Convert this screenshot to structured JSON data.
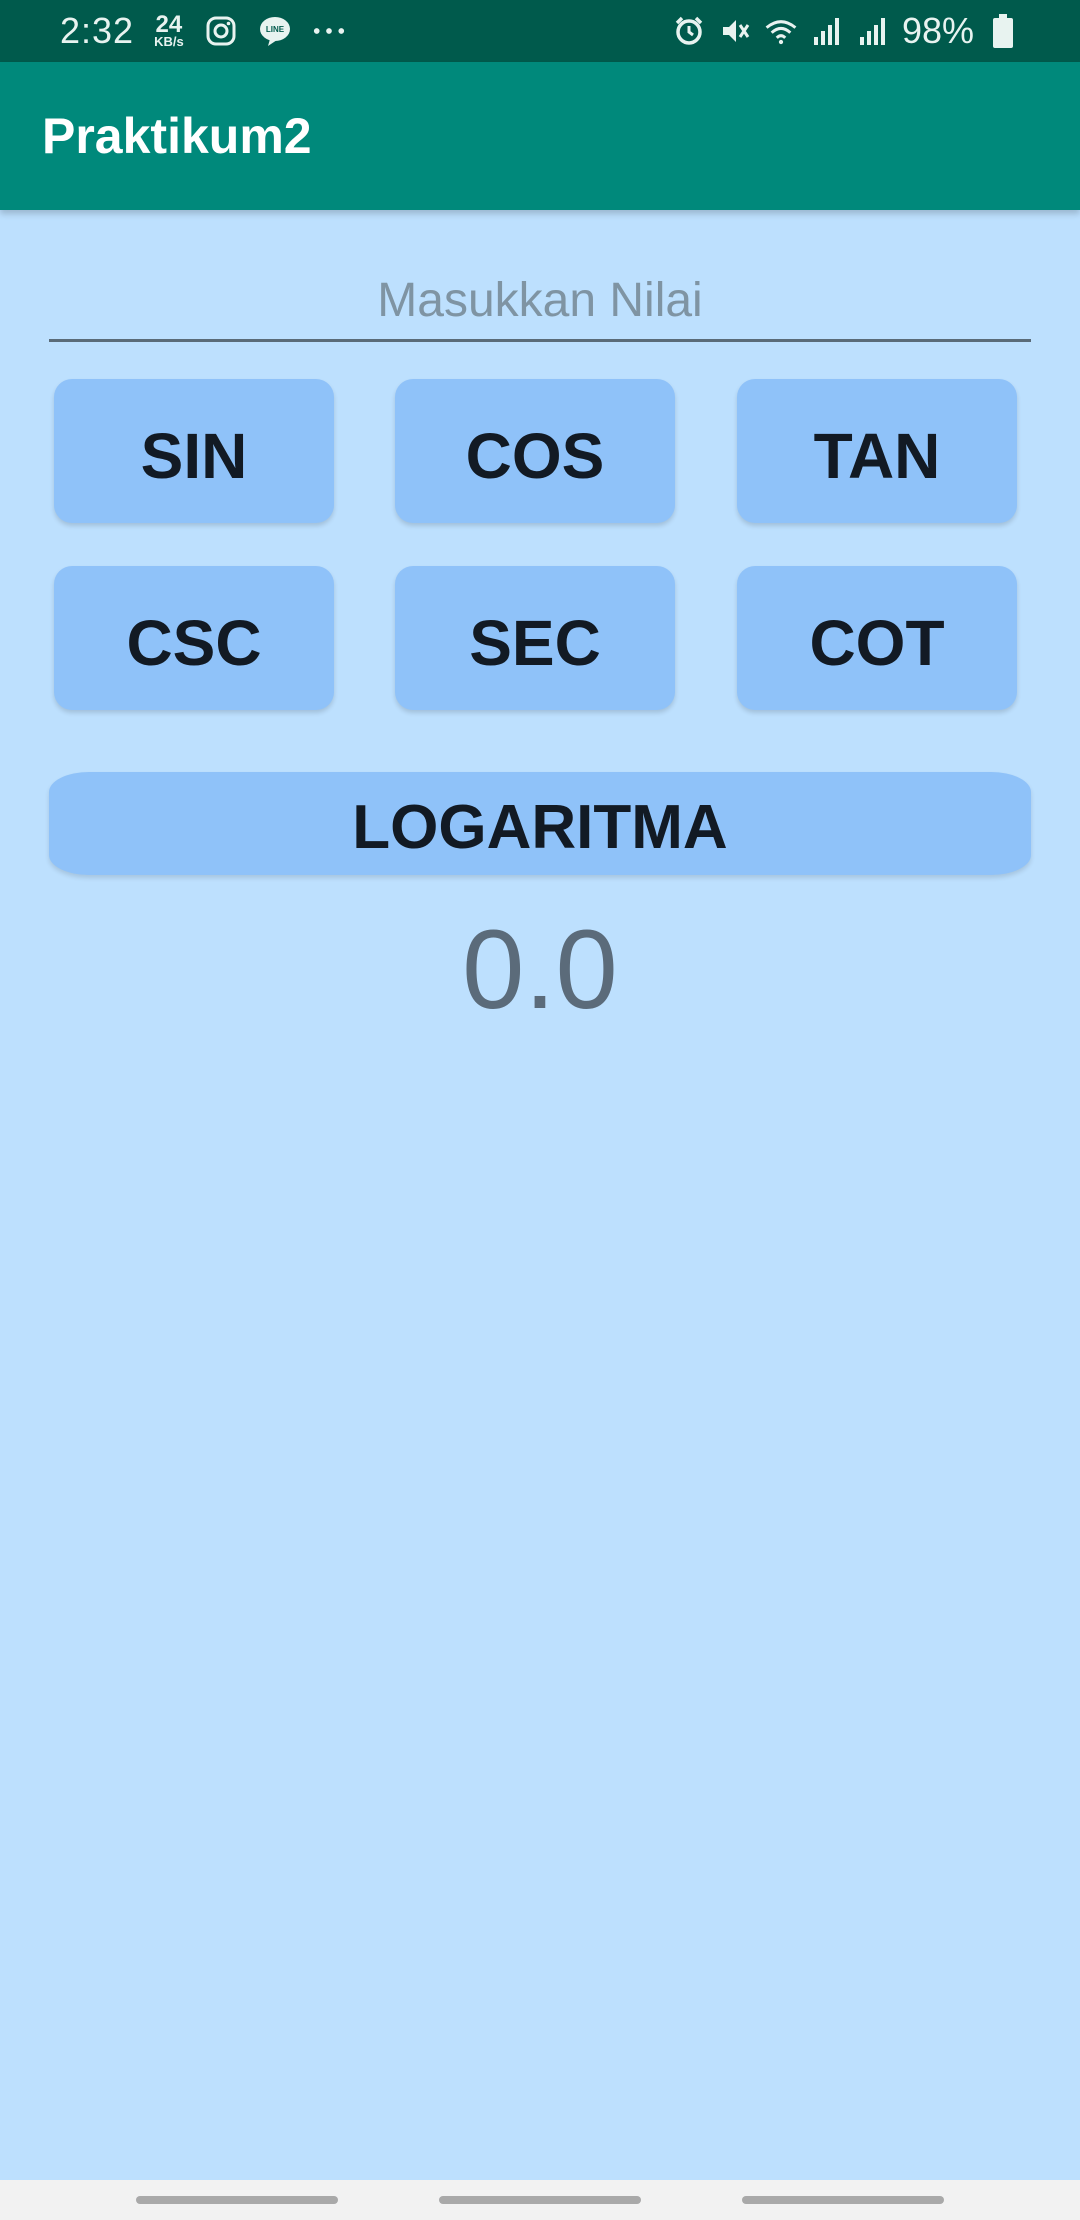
{
  "status_bar": {
    "time": "2:32",
    "speed_value": "24",
    "speed_unit": "KB/s",
    "battery": "98%",
    "left_icons": [
      "instagram-icon",
      "line-icon",
      "more-dots-icon"
    ],
    "right_icons": [
      "alarm-icon",
      "mute-icon",
      "wifi-icon",
      "signal-icon",
      "signal-icon",
      "battery-icon"
    ]
  },
  "app_bar": {
    "title": "Praktikum2"
  },
  "input": {
    "placeholder": "Masukkan Nilai",
    "value": ""
  },
  "buttons": {
    "sin": "SIN",
    "cos": "COS",
    "tan": "TAN",
    "csc": "CSC",
    "sec": "SEC",
    "cot": "COT",
    "log": "LOGARITMA"
  },
  "result": "0.0",
  "colors": {
    "status_bar": "#005a4c",
    "app_bar": "#00897b",
    "background": "#bde0fe",
    "button": "#8fc2f9"
  }
}
